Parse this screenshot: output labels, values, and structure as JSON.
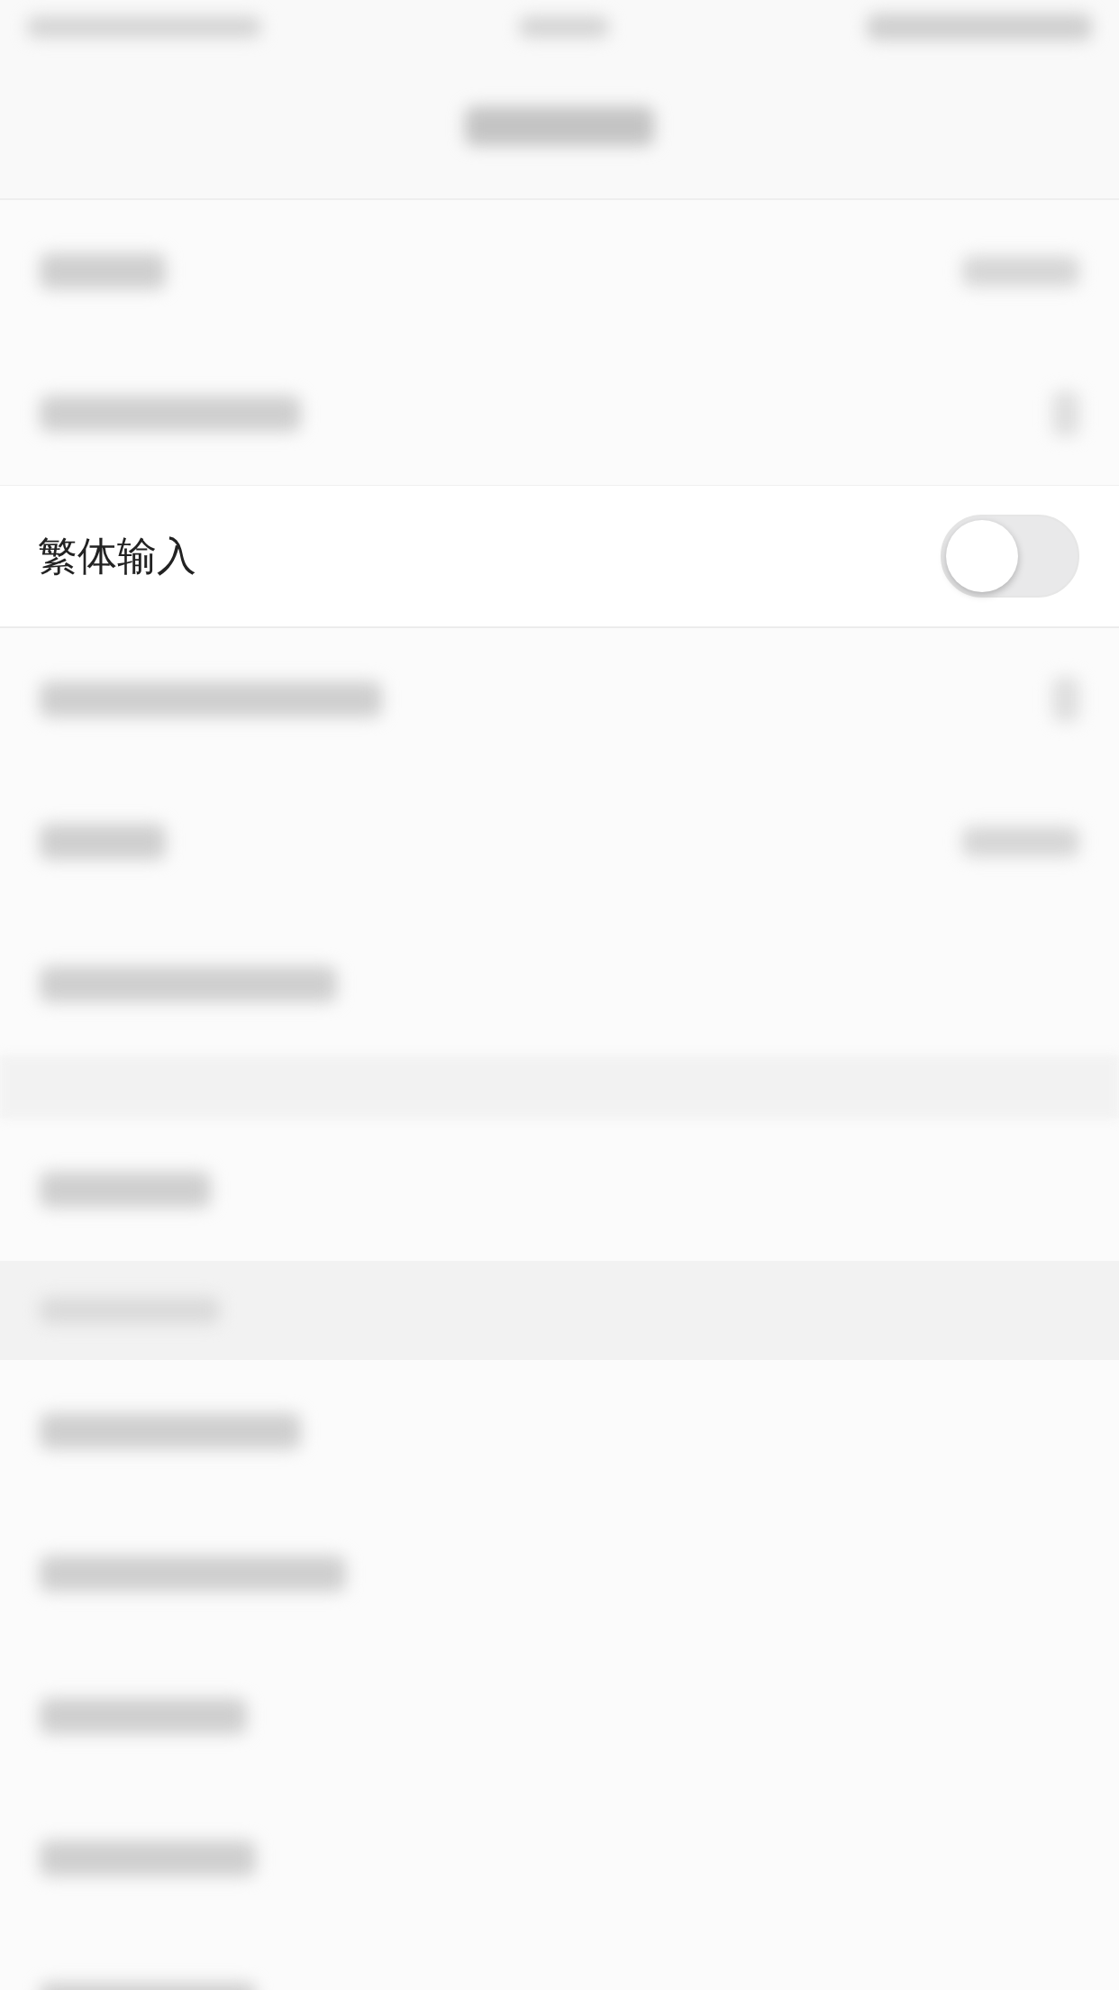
{
  "status_bar": {
    "kind": "blurred"
  },
  "nav_bar": {
    "kind": "blurred"
  },
  "rows": [
    {
      "kind": "blurred_value"
    },
    {
      "kind": "blurred_chevron"
    },
    {
      "kind": "toggle",
      "label": "繁体输入",
      "on": false
    },
    {
      "kind": "blurred_chevron"
    },
    {
      "kind": "blurred_value"
    },
    {
      "kind": "blurred"
    },
    {
      "kind": "gap"
    },
    {
      "kind": "blurred"
    },
    {
      "kind": "header"
    },
    {
      "kind": "blurred"
    },
    {
      "kind": "blurred"
    },
    {
      "kind": "blurred"
    },
    {
      "kind": "blurred"
    },
    {
      "kind": "blurred"
    }
  ]
}
